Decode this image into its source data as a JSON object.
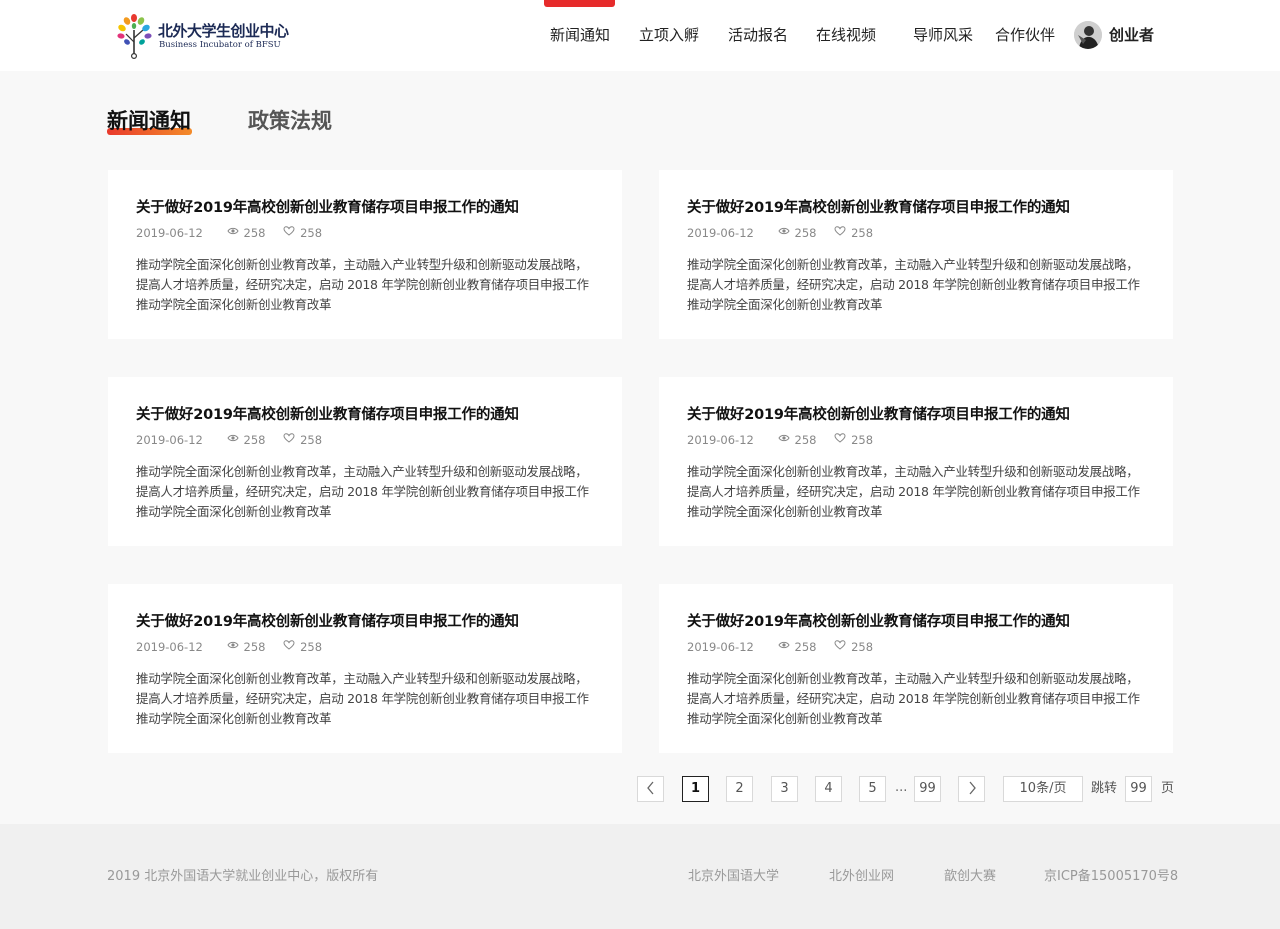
{
  "header": {
    "logo_cn": "北外大学生创业中心",
    "logo_en": "Business Incubator of BFSU",
    "nav": [
      {
        "label": "新闻通知"
      },
      {
        "label": "立项入孵"
      },
      {
        "label": "活动报名"
      },
      {
        "label": "在线视频"
      },
      {
        "label": "导师风采"
      },
      {
        "label": "合作伙伴"
      }
    ],
    "user_name": "创业者",
    "accent_color": "#e62b2b"
  },
  "tabs": [
    {
      "label": "新闻通知",
      "active": true
    },
    {
      "label": "政策法规",
      "active": false
    }
  ],
  "cards": [
    {
      "title": "关于做好2019年高校创新创业教育储存项目申报工作的通知",
      "date": "2019-06-12",
      "views": "258",
      "likes": "258",
      "desc": "推动学院全面深化创新创业教育改革，主动融入产业转型升级和创新驱动发展战略，提高人才培养质量，经研究决定，启动 2018 年学院创新创业教育储存项目申报工作推动学院全面深化创新创业教育改革"
    },
    {
      "title": "关于做好2019年高校创新创业教育储存项目申报工作的通知",
      "date": "2019-06-12",
      "views": "258",
      "likes": "258",
      "desc": "推动学院全面深化创新创业教育改革，主动融入产业转型升级和创新驱动发展战略，提高人才培养质量，经研究决定，启动 2018 年学院创新创业教育储存项目申报工作推动学院全面深化创新创业教育改革"
    },
    {
      "title": "关于做好2019年高校创新创业教育储存项目申报工作的通知",
      "date": "2019-06-12",
      "views": "258",
      "likes": "258",
      "desc": "推动学院全面深化创新创业教育改革，主动融入产业转型升级和创新驱动发展战略，提高人才培养质量，经研究决定，启动 2018 年学院创新创业教育储存项目申报工作推动学院全面深化创新创业教育改革"
    },
    {
      "title": "关于做好2019年高校创新创业教育储存项目申报工作的通知",
      "date": "2019-06-12",
      "views": "258",
      "likes": "258",
      "desc": "推动学院全面深化创新创业教育改革，主动融入产业转型升级和创新驱动发展战略，提高人才培养质量，经研究决定，启动 2018 年学院创新创业教育储存项目申报工作推动学院全面深化创新创业教育改革"
    },
    {
      "title": "关于做好2019年高校创新创业教育储存项目申报工作的通知",
      "date": "2019-06-12",
      "views": "258",
      "likes": "258",
      "desc": "推动学院全面深化创新创业教育改革，主动融入产业转型升级和创新驱动发展战略，提高人才培养质量，经研究决定，启动 2018 年学院创新创业教育储存项目申报工作推动学院全面深化创新创业教育改革"
    },
    {
      "title": "关于做好2019年高校创新创业教育储存项目申报工作的通知",
      "date": "2019-06-12",
      "views": "258",
      "likes": "258",
      "desc": "推动学院全面深化创新创业教育改革，主动融入产业转型升级和创新驱动发展战略，提高人才培养质量，经研究决定，启动 2018 年学院创新创业教育储存项目申报工作推动学院全面深化创新创业教育改革"
    }
  ],
  "icons": {
    "views": "eye-icon",
    "likes": "heart-icon",
    "prev": "chevron-left-icon",
    "next": "chevron-right-icon"
  },
  "pagination": {
    "pages": [
      "1",
      "2",
      "3",
      "4",
      "5"
    ],
    "current": "1",
    "ellipsis": "...",
    "last": "99",
    "page_size": "10条/页",
    "jump_label": "跳转",
    "jump_value": "99",
    "page_suffix": "页"
  },
  "footer": {
    "copyright": "2019 北京外国语大学就业创业中心，版权所有",
    "links": [
      "北京外国语大学",
      "北外创业网",
      "歆创大赛"
    ],
    "icp": "京ICP备15005170号8"
  }
}
